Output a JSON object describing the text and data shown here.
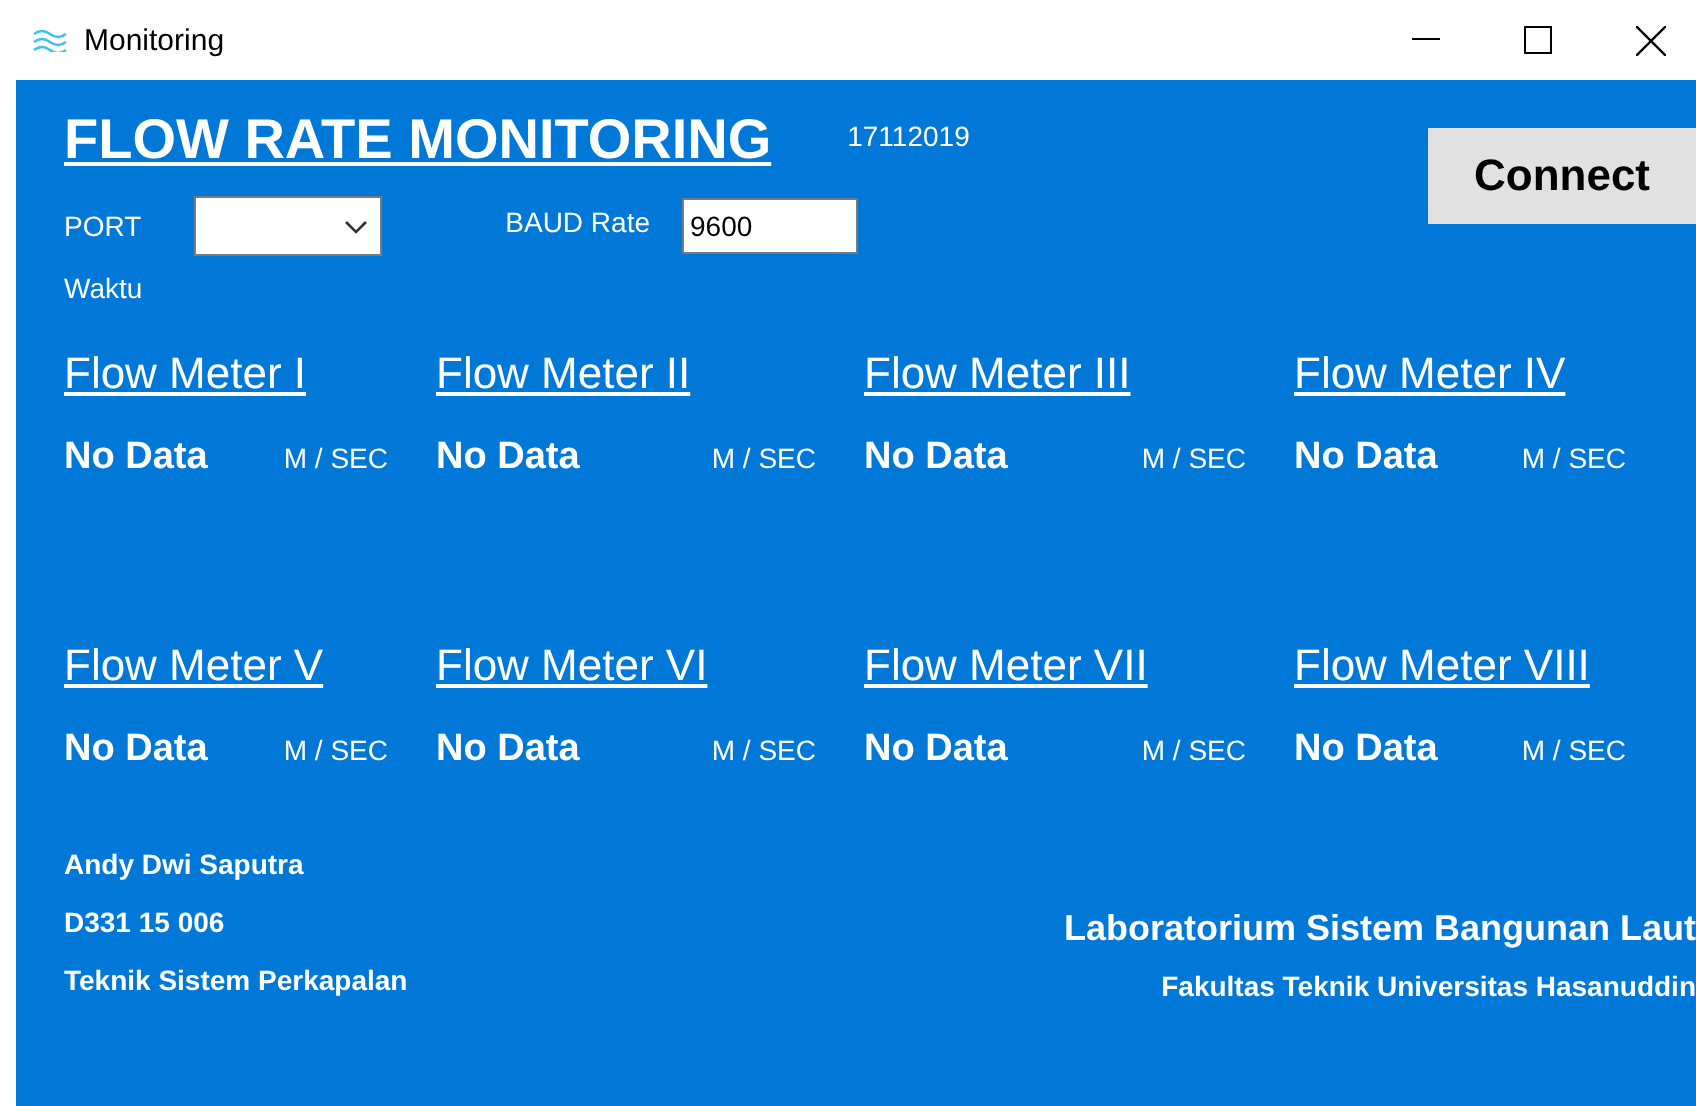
{
  "window": {
    "title": "Monitoring"
  },
  "header": {
    "title": "FLOW RATE MONITORING",
    "date": "17112019",
    "connect_button": "Connect"
  },
  "port": {
    "label": "PORT"
  },
  "baud": {
    "label": "BAUD Rate",
    "value": "9600"
  },
  "time_label": "Waktu",
  "meters": [
    {
      "name": "Flow Meter I",
      "value": "No Data",
      "unit": "M / SEC"
    },
    {
      "name": "Flow Meter II",
      "value": "No Data",
      "unit": "M / SEC"
    },
    {
      "name": "Flow Meter III",
      "value": "No Data",
      "unit": "M / SEC"
    },
    {
      "name": "Flow Meter IV",
      "value": "No Data",
      "unit": "M / SEC"
    },
    {
      "name": "Flow Meter V",
      "value": "No Data",
      "unit": "M / SEC"
    },
    {
      "name": "Flow Meter VI",
      "value": "No Data",
      "unit": "M / SEC"
    },
    {
      "name": "Flow Meter VII",
      "value": "No Data",
      "unit": "M / SEC"
    },
    {
      "name": "Flow Meter VIII",
      "value": "No Data",
      "unit": "M / SEC"
    }
  ],
  "footer": {
    "left": [
      "Andy Dwi Saputra",
      "D331 15 006",
      "Teknik Sistem Perkapalan"
    ],
    "right": [
      "Laboratorium Sistem Bangunan Laut",
      "Fakultas Teknik Universitas Hasanuddin"
    ]
  }
}
